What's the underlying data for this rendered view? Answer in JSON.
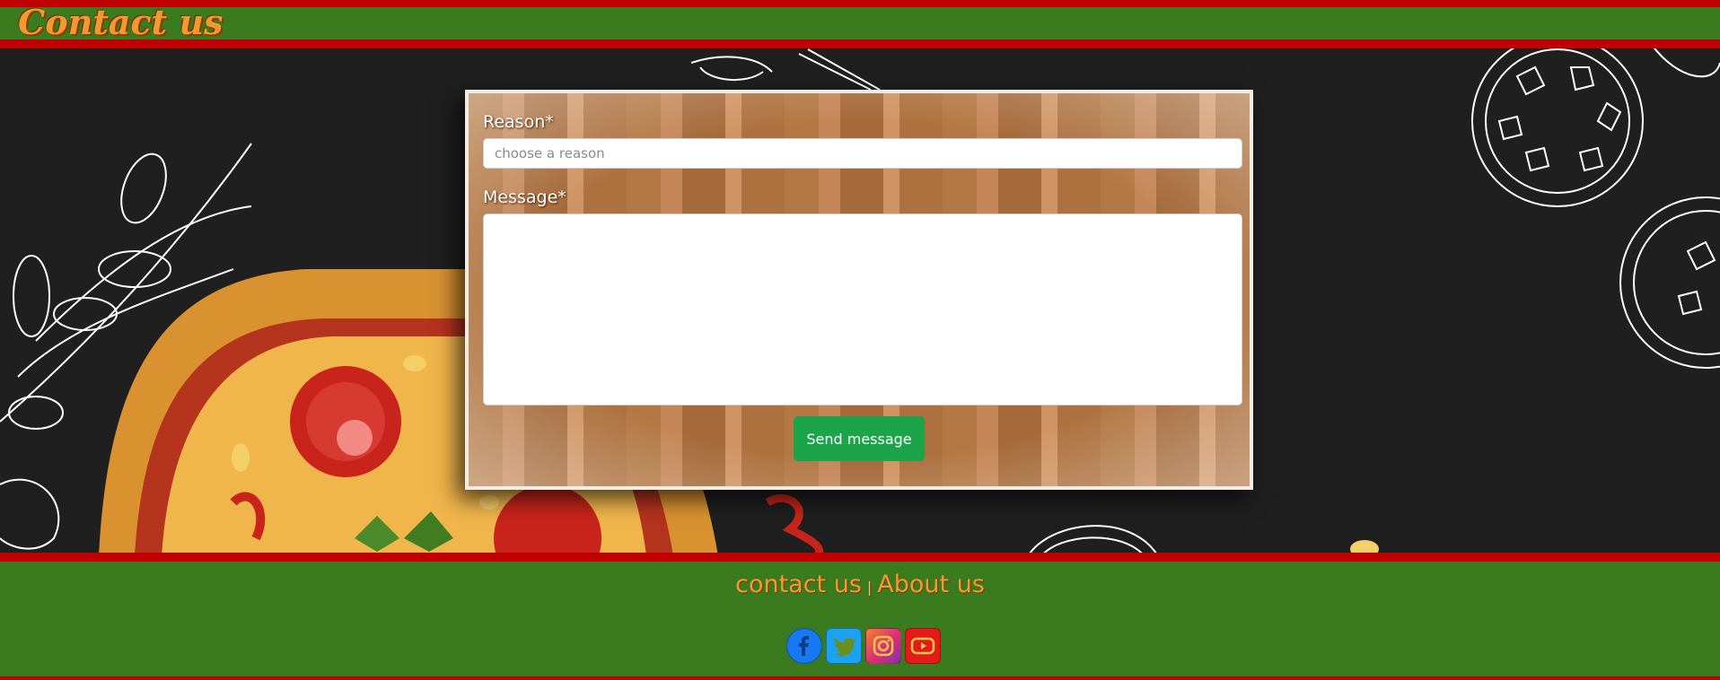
{
  "header": {
    "title": "Contact us"
  },
  "form": {
    "reason_label": "Reason*",
    "reason_placeholder": "choose a reason",
    "reason_value": "",
    "message_label": "Message*",
    "message_value": "",
    "send_label": "Send message"
  },
  "footer": {
    "links": [
      {
        "label": "contact us"
      },
      {
        "label": "About us"
      }
    ],
    "separator": "|",
    "social": [
      {
        "icon": "facebook-icon"
      },
      {
        "icon": "twitter-icon"
      },
      {
        "icon": "instagram-icon"
      },
      {
        "icon": "youtube-icon"
      }
    ]
  },
  "colors": {
    "header_red": "#c00000",
    "band_green": "#3a7b1f",
    "title_orange": "#f29a32",
    "send_green": "#1ba44a",
    "page_background": "#1f1f1f"
  }
}
